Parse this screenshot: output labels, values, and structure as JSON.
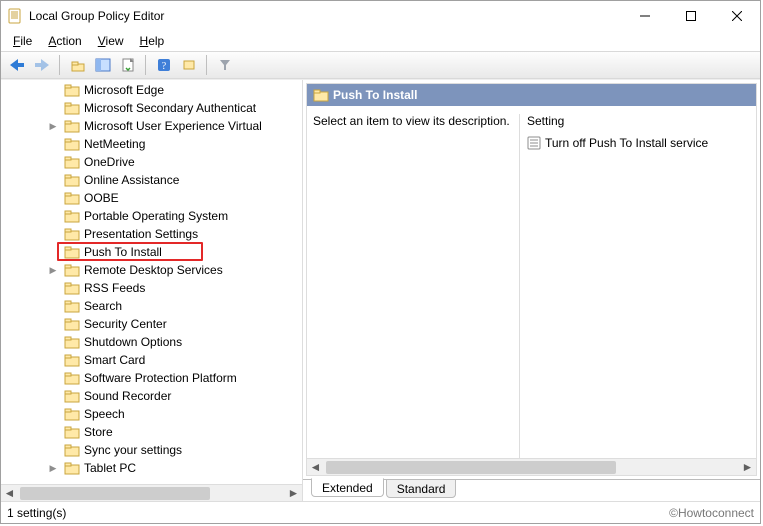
{
  "window": {
    "title": "Local Group Policy Editor"
  },
  "menus": {
    "file_pre": "F",
    "file_rest": "ile",
    "action_pre": "A",
    "action_rest": "ction",
    "view_pre": "V",
    "view_rest": "iew",
    "help_pre": "H",
    "help_rest": "elp"
  },
  "tree": {
    "items": [
      {
        "label": "Microsoft Edge",
        "chevron": ""
      },
      {
        "label": "Microsoft Secondary Authenticat",
        "chevron": ""
      },
      {
        "label": "Microsoft User Experience Virtual",
        "chevron": "▶"
      },
      {
        "label": "NetMeeting",
        "chevron": ""
      },
      {
        "label": "OneDrive",
        "chevron": ""
      },
      {
        "label": "Online Assistance",
        "chevron": ""
      },
      {
        "label": "OOBE",
        "chevron": ""
      },
      {
        "label": "Portable Operating System",
        "chevron": ""
      },
      {
        "label": "Presentation Settings",
        "chevron": ""
      },
      {
        "label": "Push To Install",
        "chevron": "",
        "highlight": true
      },
      {
        "label": "Remote Desktop Services",
        "chevron": "▶"
      },
      {
        "label": "RSS Feeds",
        "chevron": ""
      },
      {
        "label": "Search",
        "chevron": ""
      },
      {
        "label": "Security Center",
        "chevron": ""
      },
      {
        "label": "Shutdown Options",
        "chevron": ""
      },
      {
        "label": "Smart Card",
        "chevron": ""
      },
      {
        "label": "Software Protection Platform",
        "chevron": ""
      },
      {
        "label": "Sound Recorder",
        "chevron": ""
      },
      {
        "label": "Speech",
        "chevron": ""
      },
      {
        "label": "Store",
        "chevron": ""
      },
      {
        "label": "Sync your settings",
        "chevron": ""
      },
      {
        "label": "Tablet PC",
        "chevron": "▶"
      }
    ]
  },
  "details": {
    "title": "Push To Install",
    "description": "Select an item to view its description.",
    "column_header": "Setting",
    "settings": [
      {
        "label": "Turn off Push To Install service"
      }
    ]
  },
  "tabs": {
    "extended": "Extended",
    "standard": "Standard"
  },
  "status": {
    "left": "1 setting(s)",
    "right": "©Howtoconnect"
  }
}
